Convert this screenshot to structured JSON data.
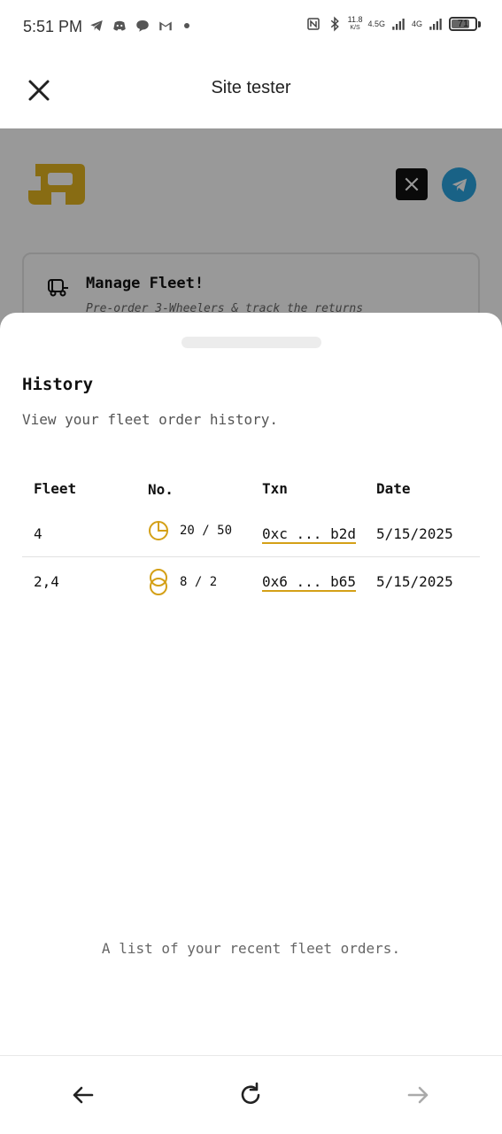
{
  "status_bar": {
    "time": "5:51 PM",
    "net_speed_value": "11.8",
    "net_speed_unit": "K/S",
    "signal_1": "4.5G",
    "signal_2": "4G",
    "battery": "71"
  },
  "header": {
    "title": "Site tester"
  },
  "background_page": {
    "card_title": "Manage Fleet!",
    "card_subtitle": "Pre-order 3-Wheelers & track the returns"
  },
  "sheet": {
    "title": "History",
    "description": "View your fleet order history.",
    "columns": [
      "Fleet",
      "No.",
      "Txn",
      "Date"
    ],
    "rows": [
      {
        "fleet": "4",
        "no": "20 / 50",
        "txn": "0xc ... b2d",
        "date": "5/15/2025",
        "icon": "pie-chart-icon"
      },
      {
        "fleet": "2,4",
        "no": "8 / 2",
        "txn": "0x6 ... b65",
        "date": "5/15/2025",
        "icon": "stacked-circles-icon"
      }
    ],
    "caption": "A list of your recent fleet orders."
  },
  "colors": {
    "accent": "#d4a017",
    "telegram": "#2aa3e0"
  }
}
